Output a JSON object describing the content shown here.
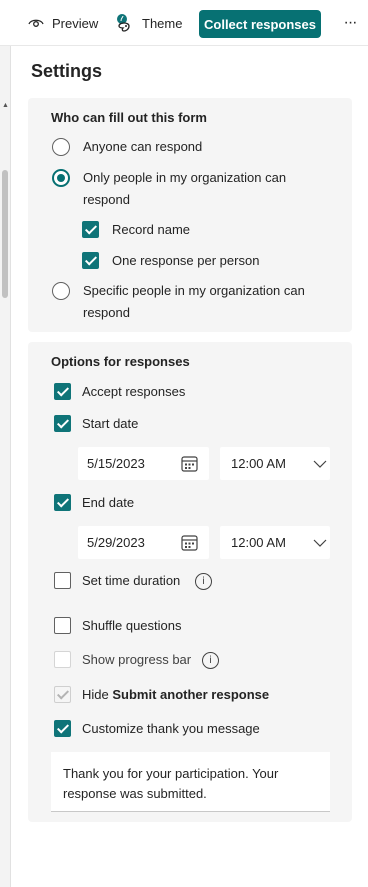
{
  "toolbar": {
    "preview_label": "Preview",
    "preview_icon": "eye-icon",
    "theme_label": "Theme",
    "theme_icon": "palette-icon",
    "collect_label": "Collect responses",
    "more_label": "···",
    "accent_color": "#077173"
  },
  "settings": {
    "title": "Settings",
    "who": {
      "title": "Who can fill out this form",
      "options": [
        {
          "label": "Anyone can respond",
          "selected": false
        },
        {
          "label": "Only people in my organization can",
          "label_line2": "respond",
          "selected": true
        },
        {
          "label": "Specific people in my organization can",
          "label_line2": "respond",
          "selected": false
        }
      ],
      "sub_options": [
        {
          "label": "Record name",
          "checked": true
        },
        {
          "label": "One response per person",
          "checked": true
        }
      ]
    },
    "responses": {
      "title": "Options for responses",
      "accept": {
        "label": "Accept responses",
        "checked": true
      },
      "start": {
        "label": "Start date",
        "checked": true,
        "date": "5/15/2023",
        "time": "12:00 AM"
      },
      "end": {
        "label": "End date",
        "checked": true,
        "date": "5/29/2023",
        "time": "12:00 AM"
      },
      "duration": {
        "label": "Set time duration",
        "checked": false
      },
      "shuffle": {
        "label": "Shuffle questions",
        "checked": false
      },
      "progress": {
        "label": "Show progress bar",
        "checked": false
      },
      "hide_submit": {
        "prefix": "Hide ",
        "bold": "Submit another response",
        "checked": true,
        "disabled": true
      },
      "thank_you": {
        "label": "Customize thank you message",
        "checked": true,
        "message_line1": "Thank you for your participation. Your",
        "message_line2": "response was submitted."
      }
    }
  }
}
